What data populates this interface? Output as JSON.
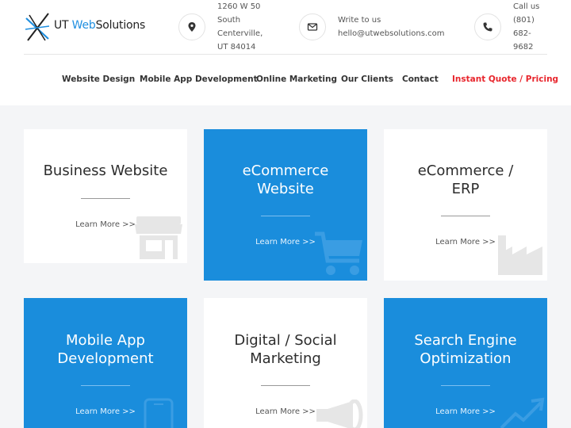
{
  "brand": {
    "logo_parts": [
      "UT",
      "Web",
      "Solutions"
    ]
  },
  "contact": {
    "address_lines": [
      "1260 W 50",
      "South",
      "Centerville,",
      "UT 84014"
    ],
    "write_lines": [
      "Write to us",
      "hello@utwebsolutions.com"
    ],
    "call_lines": [
      "Call us",
      "(801)",
      "682-",
      "9682"
    ]
  },
  "nav": {
    "items": [
      "Website Design",
      "Mobile App Development",
      "Online Marketing",
      "Our Clients",
      "Contact",
      "Instant Quote / Pricing"
    ]
  },
  "cards": [
    {
      "title_lines": [
        "Business Website"
      ],
      "link": "Learn More >>",
      "icon": "storefront-icon",
      "style": "white"
    },
    {
      "title_lines": [
        "eCommerce",
        "Website"
      ],
      "link": "Learn More >>",
      "icon": "shopping-cart-icon",
      "style": "blue"
    },
    {
      "title_lines": [
        "eCommerce /",
        "ERP"
      ],
      "link": "Learn More >>",
      "icon": "factory-icon",
      "style": "white"
    },
    {
      "title_lines": [
        "Mobile App",
        "Development"
      ],
      "link": "Learn More >>",
      "icon": "mobile-phone-icon",
      "style": "blue"
    },
    {
      "title_lines": [
        "Digital / Social",
        "Marketing"
      ],
      "link": "Learn More >>",
      "icon": "megaphone-icon",
      "style": "white"
    },
    {
      "title_lines": [
        "Search Engine",
        "Optimization"
      ],
      "link": "Learn More >>",
      "icon": "growth-chart-icon",
      "style": "blue"
    }
  ],
  "colors": {
    "accent": "#1a8ddc",
    "quote": "#e8262d",
    "background": "#f4f5f7"
  }
}
